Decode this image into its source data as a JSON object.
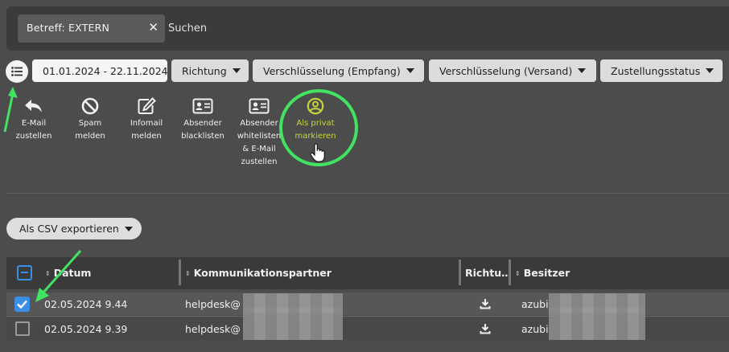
{
  "search": {
    "chip_label": "Betreff:  EXTERN",
    "chip_remove": "✕",
    "placeholder": "Suchen"
  },
  "filters": {
    "date_range": "01.01.2024 - 22.11.2024",
    "direction": "Richtung",
    "encryption_receive": "Verschlüsselung (Empfang)",
    "encryption_send": "Verschlüsselung (Versand)",
    "delivery_status": "Zustellungsstatus"
  },
  "actions": [
    {
      "line1": "E-Mail",
      "line2": "zustellen",
      "icon": "reply-icon"
    },
    {
      "line1": "Spam",
      "line2": "melden",
      "icon": "ban-icon"
    },
    {
      "line1": "Infomail",
      "line2": "melden",
      "icon": "edit-icon"
    },
    {
      "line1": "Absender",
      "line2": "blacklisten",
      "icon": "id-card-icon"
    },
    {
      "line1": "Absender",
      "line2": "whitelisten",
      "line3": "& E-Mail",
      "line4": "zustellen",
      "icon": "id-card-icon"
    },
    {
      "line1": "Als privat",
      "line2": "markieren",
      "icon": "user-circle-icon",
      "color": "#c9d43b"
    }
  ],
  "export": {
    "label": "Als CSV exportieren"
  },
  "table": {
    "columns": [
      "Datum",
      "Kommunikationspartner",
      "Richtu…",
      "Besitzer"
    ],
    "rows": [
      {
        "date": "02.05.2024 9.44",
        "partner": "helpdesk@",
        "owner": "azubi",
        "checked": true
      },
      {
        "date": "02.05.2024 9.39",
        "partner": "helpdesk@",
        "owner": "azubi",
        "checked": false
      }
    ]
  },
  "colors": {
    "accent": "#3a8ee6",
    "highlight": "#41e361",
    "active_action": "#c9d43b"
  }
}
